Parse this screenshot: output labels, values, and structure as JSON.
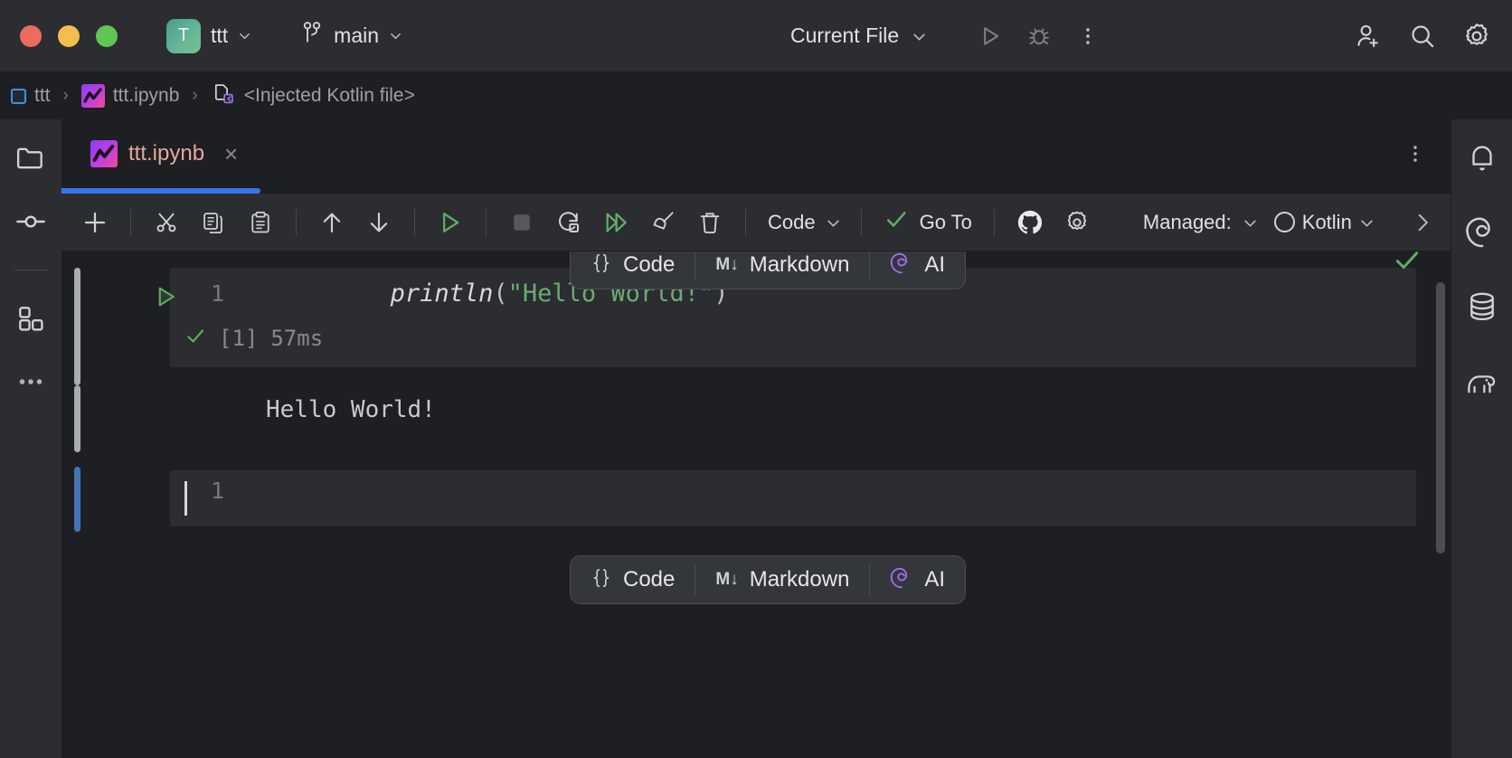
{
  "titlebar": {
    "project_name": "ttt",
    "project_initial": "T",
    "branch": "main",
    "run_config": "Current File",
    "icons": {
      "run": "run-icon",
      "debug": "debug-icon",
      "more": "more-vertical-icon",
      "add_user": "add-user-icon",
      "search": "search-icon",
      "settings": "settings-gear-icon"
    }
  },
  "breadcrumbs": {
    "items": [
      {
        "label": "ttt",
        "icon": "module-icon"
      },
      {
        "label": "ttt.ipynb",
        "icon": "notebook-icon"
      },
      {
        "label": "<Injected Kotlin file>",
        "icon": "injected-fragment-icon"
      }
    ],
    "separator": "›"
  },
  "left_rail": {
    "items": [
      {
        "name": "project-tool-window",
        "icon": "folder-icon"
      },
      {
        "name": "commit-tool-window",
        "icon": "commit-node-icon"
      },
      {
        "name": "plugins-tool-window",
        "icon": "squares-icon"
      },
      {
        "name": "more-tool-windows",
        "icon": "ellipsis-icon"
      }
    ]
  },
  "right_rail": {
    "items": [
      {
        "name": "notifications",
        "icon": "bell-icon"
      },
      {
        "name": "ai-assistant",
        "icon": "ai-spiral-icon"
      },
      {
        "name": "database",
        "icon": "database-icon"
      },
      {
        "name": "big-data-tools",
        "icon": "elephant-icon"
      }
    ]
  },
  "editor_tab": {
    "label": "ttt.ipynb",
    "close": "×",
    "more": "more-vertical-icon"
  },
  "notebook_toolbar": {
    "buttons": [
      {
        "name": "add-cell",
        "icon": "plus-icon",
        "label": ""
      },
      {
        "name": "cut-cell",
        "icon": "scissors-icon",
        "label": ""
      },
      {
        "name": "copy-cell",
        "icon": "copy-icon",
        "label": ""
      },
      {
        "name": "paste-cell",
        "icon": "paste-icon",
        "label": ""
      },
      {
        "name": "move-cell-up",
        "icon": "arrow-up-icon",
        "label": ""
      },
      {
        "name": "move-cell-down",
        "icon": "arrow-down-icon",
        "label": ""
      },
      {
        "name": "run-cell",
        "icon": "run-triangle-icon",
        "label": ""
      },
      {
        "name": "interrupt-kernel",
        "icon": "stop-square-icon",
        "label": ""
      },
      {
        "name": "restart-kernel",
        "icon": "restart-icon",
        "label": ""
      },
      {
        "name": "run-all-cells",
        "icon": "run-all-icon",
        "label": ""
      },
      {
        "name": "clear-outputs",
        "icon": "broom-icon",
        "label": ""
      },
      {
        "name": "delete-cell",
        "icon": "trash-icon",
        "label": ""
      }
    ],
    "cell_type": "Code",
    "go_to": "Go To",
    "github": "github-icon",
    "jupyter_settings": "settings-gear-icon",
    "managed_label": "Managed:",
    "kernel": "Kotlin",
    "expand": "chevron-right-icon"
  },
  "cell_popup": {
    "code": "Code",
    "code_icon": "braces-icon",
    "markdown": "Markdown",
    "markdown_icon": "M↓",
    "ai": "AI",
    "ai_icon": "ai-spiral-icon"
  },
  "cells": [
    {
      "name": "code-cell-1",
      "line_number": "1",
      "code_fn": "println",
      "code_open": "(",
      "code_string": "\"Hello World!\"",
      "code_close": ")",
      "exec_count": "[1]",
      "exec_time": "57ms",
      "exec_status_icon": "check-icon",
      "output": "Hello World!",
      "state": "executed"
    },
    {
      "name": "code-cell-2",
      "line_number": "1",
      "code_text": "",
      "state": "selected-empty"
    }
  ],
  "colors": {
    "accent_blue": "#3574f0",
    "selected_cell_bar": "#4175b5",
    "idle_cell_bar": "#a7abb2",
    "success_green": "#5fad65",
    "string_green": "#6aab73",
    "ai_purple": "#a36ded",
    "tab_filename": "#e8a5a0",
    "titlebar_bg": "#2b2d30",
    "editor_bg": "#1e1f22",
    "cell_bg": "#2b2d30"
  }
}
